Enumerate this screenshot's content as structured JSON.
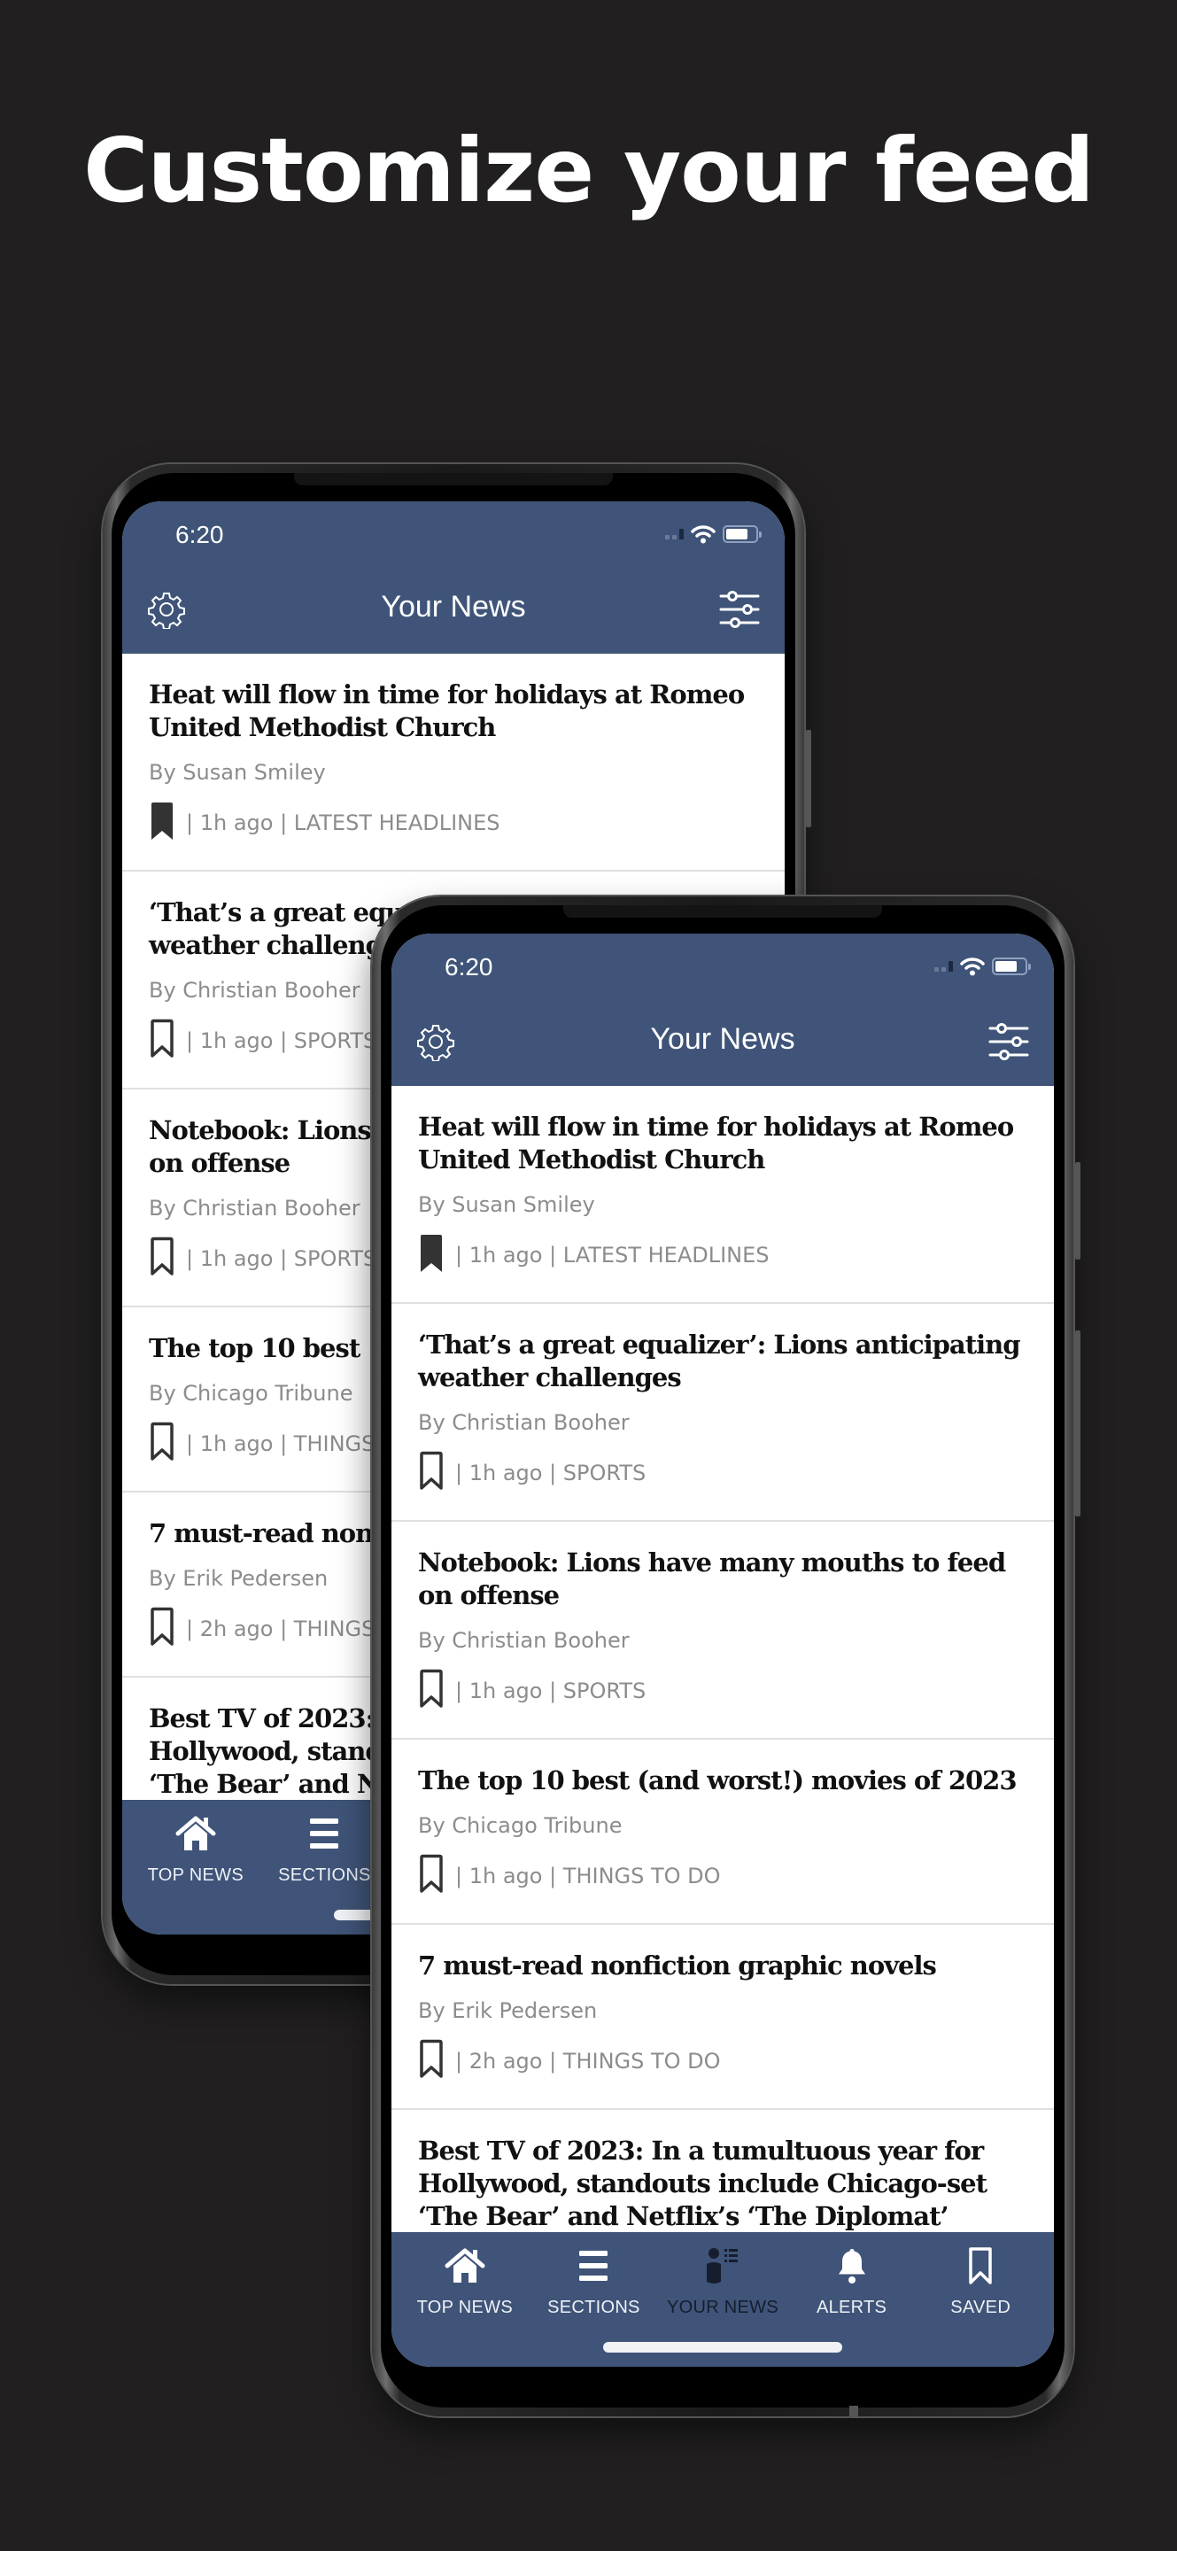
{
  "promo": {
    "title": "Customize your feed"
  },
  "colors": {
    "background": "#211f20",
    "brand_bar": "#3f5478",
    "headline": "#111111",
    "meta": "#8c8c8c"
  },
  "status_bar": {
    "time": "6:20",
    "icons": [
      "signal-icon",
      "wifi-icon",
      "battery-icon"
    ]
  },
  "header": {
    "title": "Your News",
    "left_icon": "gear-icon",
    "right_icon": "filter-sliders-icon"
  },
  "articles": [
    {
      "headline": "Heat will flow in time for holidays at Romeo United Methodist Church",
      "byline": "By Susan Smiley",
      "meta": "| 1h ago | LATEST HEADLINES",
      "saved": true
    },
    {
      "headline": "‘That’s a great equalizer’: Lions anticipating weather challenges",
      "byline": "By Christian Booher",
      "meta": "| 1h ago | SPORTS",
      "saved": false
    },
    {
      "headline": "Notebook: Lions have many mouths to feed on offense",
      "byline": "By Christian Booher",
      "meta": "| 1h ago | SPORTS",
      "saved": false
    },
    {
      "headline": "The top 10 best (and worst!) movies of 2023",
      "byline": "By Chicago Tribune",
      "meta": "| 1h ago | THINGS TO DO",
      "saved": false
    },
    {
      "headline": "7 must-read nonfiction graphic novels",
      "byline": "By Erik Pedersen",
      "meta": "| 2h ago | THINGS TO DO",
      "saved": false
    },
    {
      "headline": "Best TV of 2023: In a tumultuous year for Hollywood, standouts include Chicago-set ‘The Bear’ and Netflix’s ‘The Diplomat’",
      "byline": "",
      "meta": "",
      "saved": false
    }
  ],
  "nav": [
    {
      "label": "TOP NEWS",
      "icon": "home-icon",
      "active": false
    },
    {
      "label": "SECTIONS",
      "icon": "menu-icon",
      "active": false
    },
    {
      "label": "YOUR NEWS",
      "icon": "person-list-icon",
      "active": true
    },
    {
      "label": "ALERTS",
      "icon": "bell-icon",
      "active": false
    },
    {
      "label": "SAVED",
      "icon": "bookmark-icon",
      "active": false
    }
  ]
}
